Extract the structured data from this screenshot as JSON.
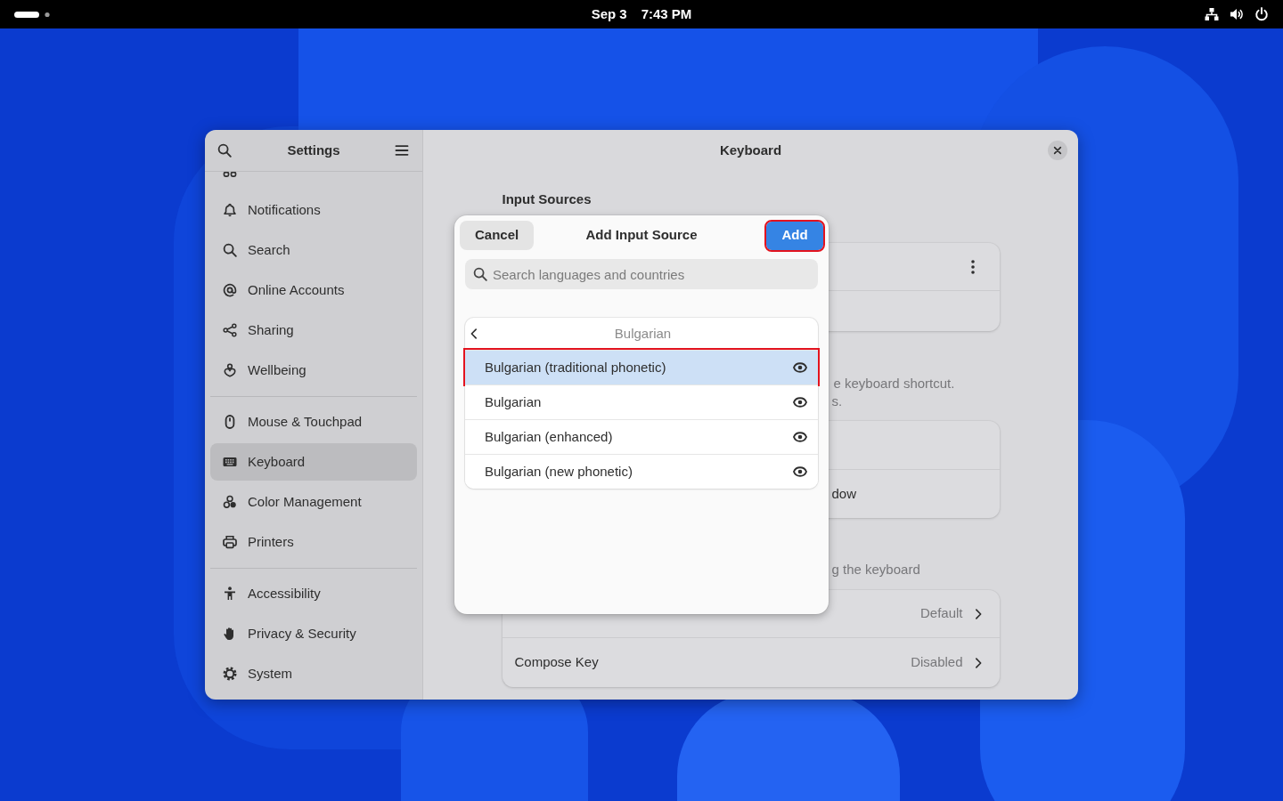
{
  "top_bar": {
    "date": "Sep 3",
    "time": "7:43 PM"
  },
  "sidebar": {
    "title": "Settings",
    "groups": [
      {
        "items": [
          {
            "label": "Notifications",
            "selected": false
          },
          {
            "label": "Search",
            "selected": false
          },
          {
            "label": "Online Accounts",
            "selected": false
          },
          {
            "label": "Sharing",
            "selected": false
          },
          {
            "label": "Wellbeing",
            "selected": false
          }
        ]
      },
      {
        "items": [
          {
            "label": "Mouse & Touchpad",
            "selected": false
          },
          {
            "label": "Keyboard",
            "selected": true
          },
          {
            "label": "Color Management",
            "selected": false
          },
          {
            "label": "Printers",
            "selected": false
          }
        ]
      },
      {
        "items": [
          {
            "label": "Accessibility",
            "selected": false
          },
          {
            "label": "Privacy & Security",
            "selected": false
          },
          {
            "label": "System",
            "selected": false
          }
        ]
      }
    ]
  },
  "page": {
    "title": "Keyboard",
    "input_sources": {
      "heading": "Input Sources"
    },
    "switching": {
      "description_lines": [
        "e keyboard shortcut.",
        "s."
      ],
      "option_fragment": "dow"
    },
    "special_entry": {
      "description": "g the keyboard",
      "rows": [
        {
          "value": "Default"
        },
        {
          "label": "Compose Key",
          "value": "Disabled"
        }
      ]
    }
  },
  "dialog": {
    "title": "Add Input Source",
    "cancel_button": "Cancel",
    "add_button": {
      "label": "Add",
      "highlighted": true
    },
    "search": {
      "placeholder": "Search languages and countries"
    },
    "list": {
      "header": "Bulgarian",
      "items": [
        {
          "label": "Bulgarian (traditional phonetic)",
          "selected": true,
          "highlighted": true
        },
        {
          "label": "Bulgarian",
          "selected": false,
          "highlighted": false
        },
        {
          "label": "Bulgarian (enhanced)",
          "selected": false,
          "highlighted": false
        },
        {
          "label": "Bulgarian (new phonetic)",
          "selected": false,
          "highlighted": false
        }
      ]
    }
  }
}
